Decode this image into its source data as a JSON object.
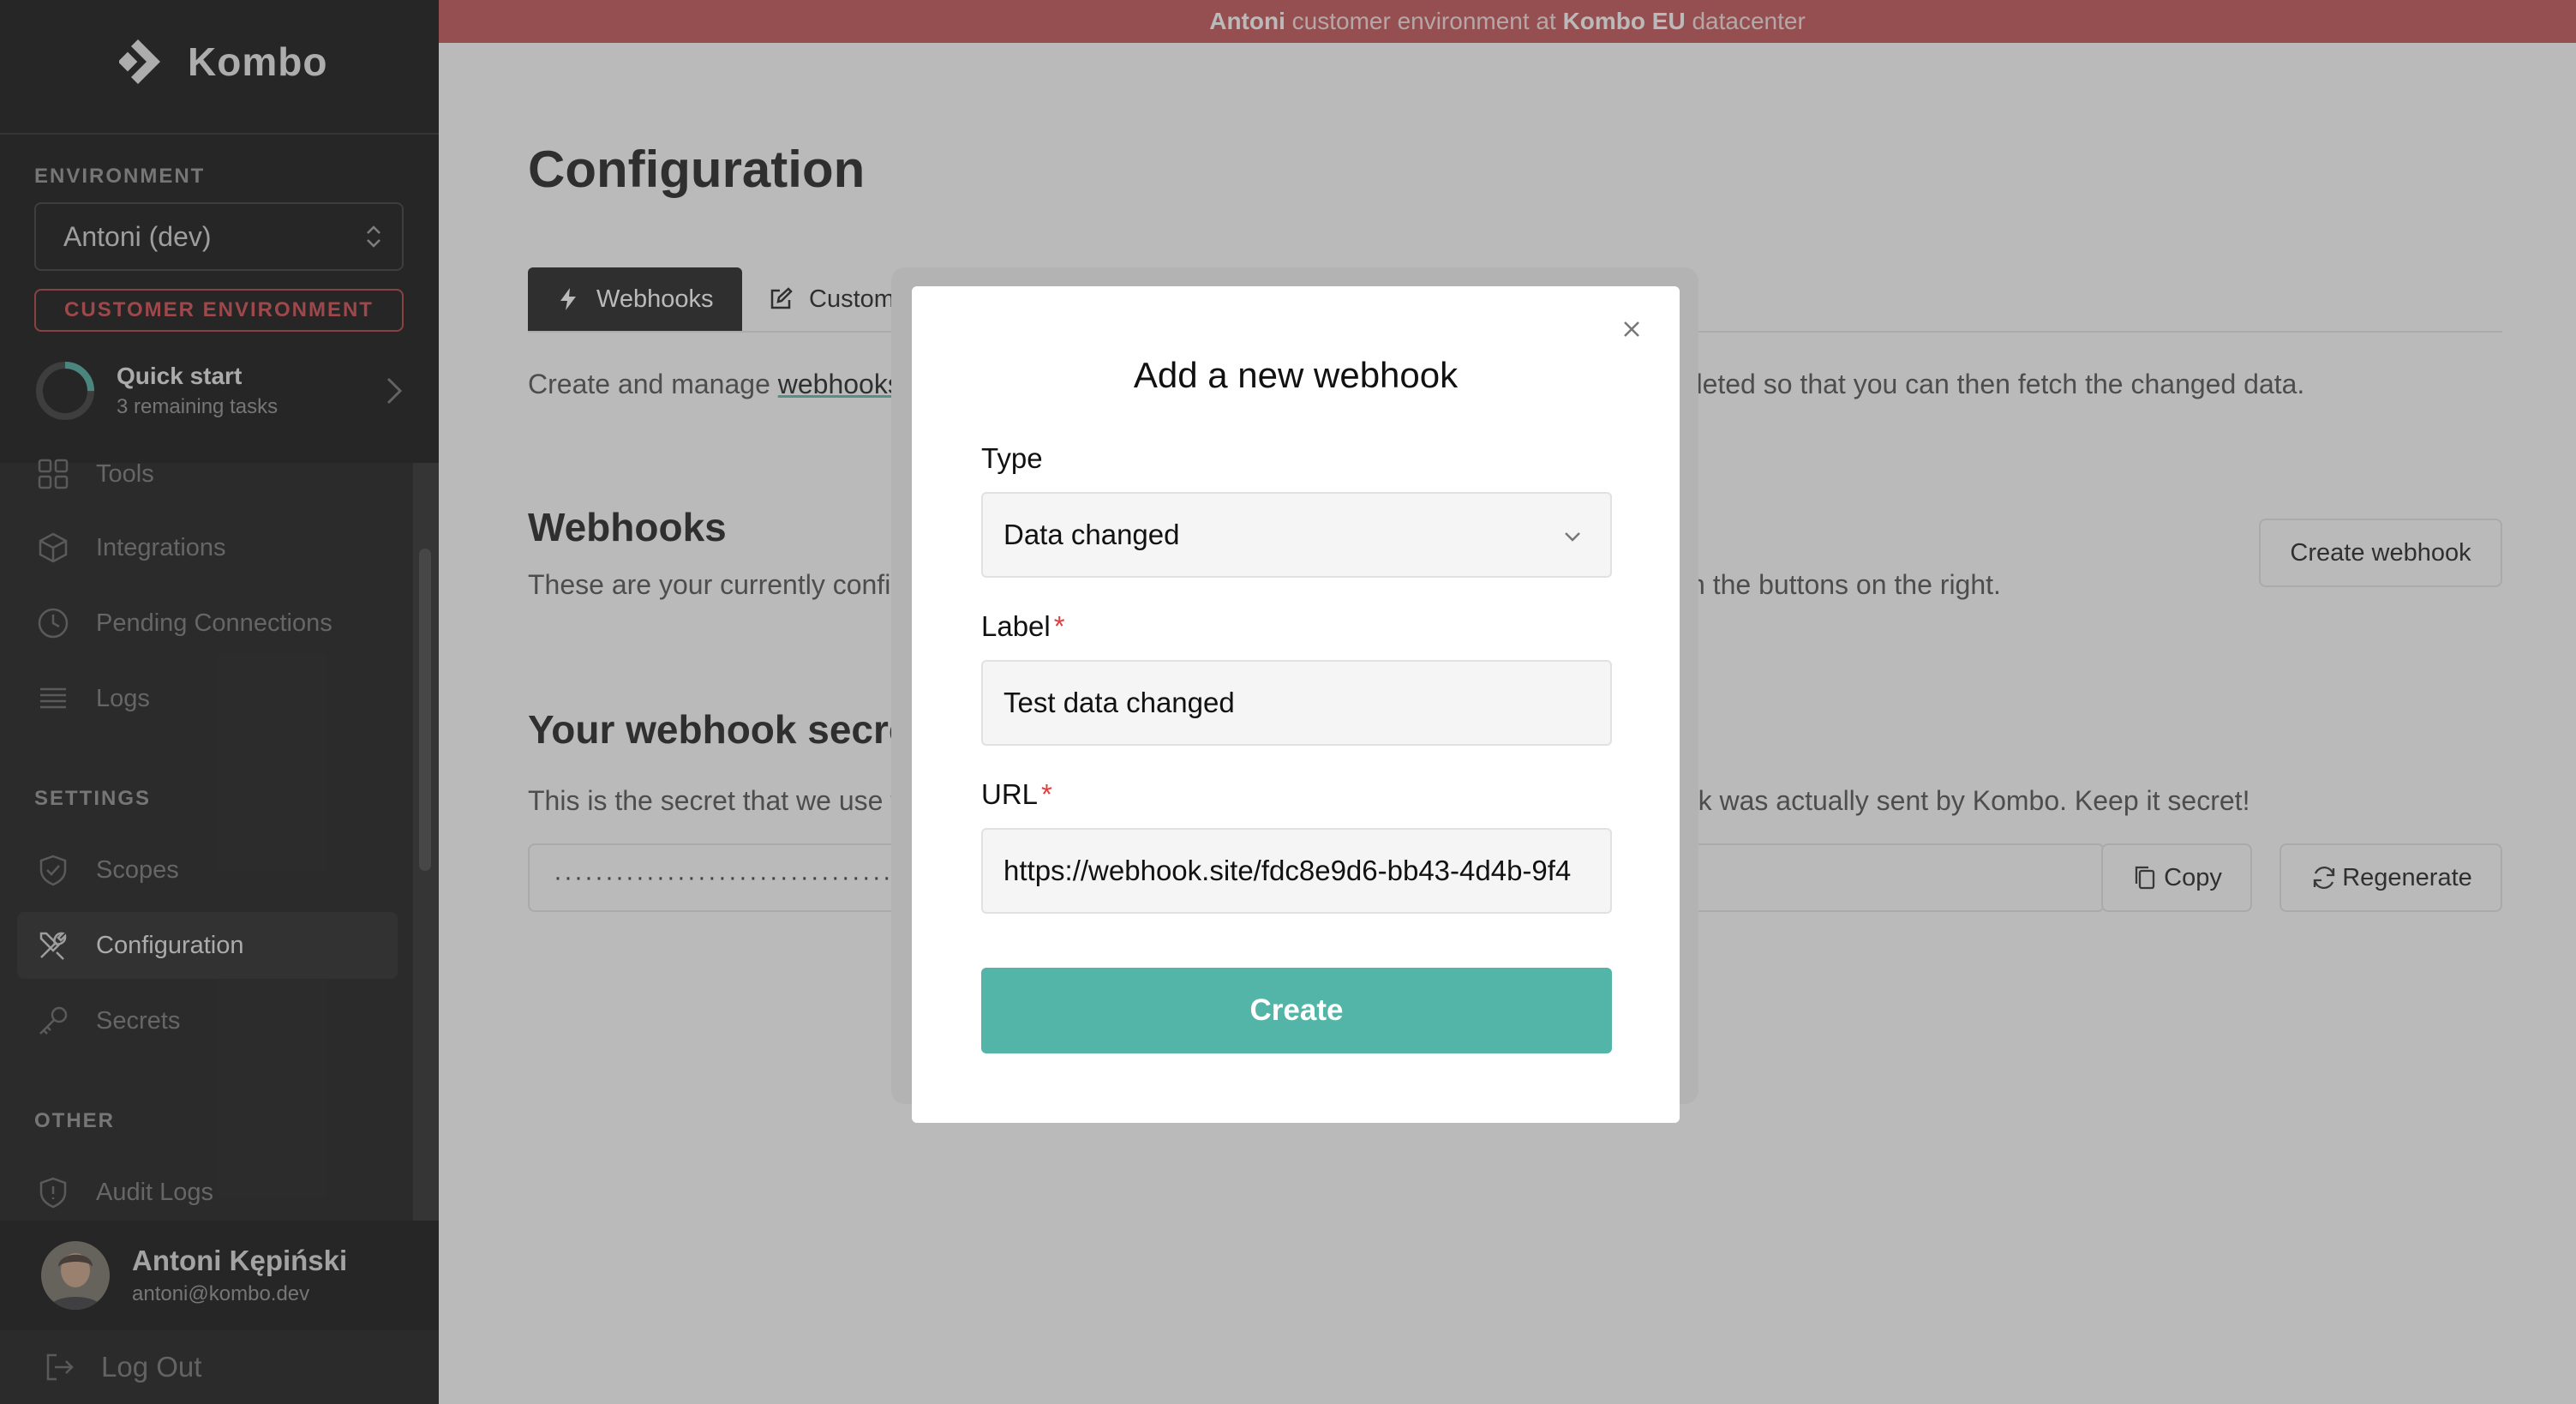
{
  "banner": {
    "tenant": "Antoni",
    "middle": " customer environment at ",
    "datacenter": "Kombo EU",
    "suffix": " datacenter"
  },
  "sidebar": {
    "brand": "Kombo",
    "environment_label": "ENVIRONMENT",
    "environment_value": "Antoni (dev)",
    "customer_env_badge": "CUSTOMER ENVIRONMENT",
    "quick_start": {
      "title": "Quick start",
      "subtitle": "3 remaining tasks",
      "progress": 0.25
    },
    "nav": [
      {
        "label": "Tools",
        "icon": "grid-icon"
      },
      {
        "label": "Integrations",
        "icon": "cube-icon"
      },
      {
        "label": "Pending Connections",
        "icon": "clock-icon"
      },
      {
        "label": "Logs",
        "icon": "list-icon"
      }
    ],
    "settings_label": "SETTINGS",
    "settings_nav": [
      {
        "label": "Scopes",
        "icon": "shield-check-icon"
      },
      {
        "label": "Configuration",
        "icon": "tools-icon",
        "active": true
      },
      {
        "label": "Secrets",
        "icon": "key-icon"
      }
    ],
    "other_label": "OTHER",
    "other_nav": [
      {
        "label": "Audit Logs",
        "icon": "shield-icon"
      }
    ],
    "user": {
      "name": "Antoni Kępiński",
      "email": "antoni@kombo.dev"
    },
    "logout": "Log Out"
  },
  "main": {
    "title": "Configuration",
    "tabs": [
      {
        "label": "Webhooks",
        "icon": "bolt-icon",
        "active": true
      },
      {
        "label": "Custom F",
        "icon": "edit-icon"
      }
    ],
    "intro": {
      "before": "Create and manage ",
      "link": "webhooks",
      "after_hidden": "",
      "tail": "mpleted so that you can then fetch the changed data."
    },
    "webhooks": {
      "heading": "Webhooks",
      "subtitle_start": "These are your currently config",
      "subtitle_end": "ith the buttons on the right.",
      "create_button": "Create webhook"
    },
    "secret": {
      "heading": "Your webhook secret",
      "subtitle_start": "This is the secret that we use to",
      "subtitle_end": "ook was actually sent by Kombo. Keep it secret!",
      "masked_value": "································································",
      "copy_button": "Copy",
      "regenerate_button": "Regenerate"
    }
  },
  "modal": {
    "title": "Add a new webhook",
    "type_label": "Type",
    "type_value": "Data changed",
    "label_label": "Label",
    "label_value": "Test data changed",
    "url_label": "URL",
    "url_value": "https://webhook.site/fdc8e9d6-bb43-4d4b-9f4",
    "required_mark": "*",
    "create_button": "Create"
  }
}
